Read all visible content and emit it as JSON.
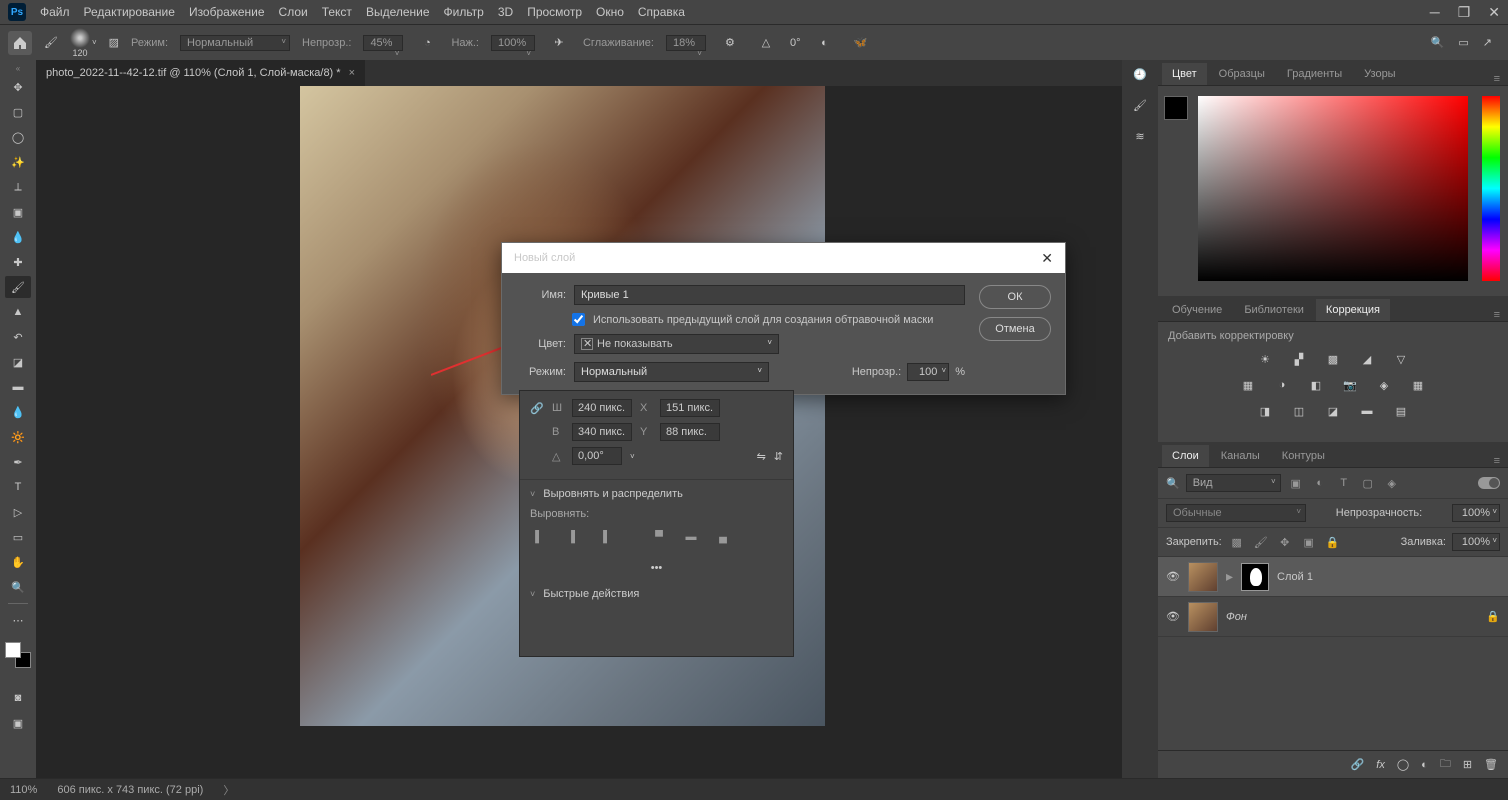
{
  "menubar": {
    "items": [
      "Файл",
      "Редактирование",
      "Изображение",
      "Слои",
      "Текст",
      "Выделение",
      "Фильтр",
      "3D",
      "Просмотр",
      "Окно",
      "Справка"
    ]
  },
  "optbar": {
    "brush_size": "120",
    "mode_label": "Режим:",
    "mode_value": "Нормальный",
    "opacity_label": "Непрозр.:",
    "opacity_value": "45%",
    "flow_label": "Наж.:",
    "flow_value": "100%",
    "smooth_label": "Сглаживание:",
    "smooth_value": "18%",
    "angle_value": "0°"
  },
  "tab_title": "photo_2022-11--42-12.tif @ 110% (Слой 1, Слой-маска/8) *",
  "dialog": {
    "title": "Новый слой",
    "name_label": "Имя:",
    "name_value": "Кривые 1",
    "clip_label": "Использовать предыдущий слой для создания обтравочной маски",
    "color_label": "Цвет:",
    "color_value": "Не показывать",
    "mode_label": "Режим:",
    "mode_value": "Нормальный",
    "opacity_label": "Непрозр.:",
    "opacity_value": "100",
    "opacity_pct": "%",
    "ok": "ОК",
    "cancel": "Отмена"
  },
  "props": {
    "w_label": "Ш",
    "w": "240 пикс.",
    "x_label": "X",
    "x": "151 пикс.",
    "h_label": "В",
    "h": "340 пикс.",
    "y_label": "Y",
    "y": "88 пикс.",
    "angle": "0,00°",
    "align_title": "Выровнять и распределить",
    "align_sub": "Выровнять:",
    "quick_title": "Быстрые действия"
  },
  "right": {
    "color_tabs": [
      "Цвет",
      "Образцы",
      "Градиенты",
      "Узоры"
    ],
    "mid_tabs": [
      "Обучение",
      "Библиотеки",
      "Коррекция"
    ],
    "corr_label": "Добавить корректировку",
    "layer_tabs": [
      "Слои",
      "Каналы",
      "Контуры"
    ],
    "search_placeholder": "Вид",
    "blend": "Обычные",
    "opacity_label": "Непрозрачность:",
    "opacity": "100%",
    "lock_label": "Закрепить:",
    "fill_label": "Заливка:",
    "fill": "100%",
    "layers": [
      {
        "name": "Слой 1"
      },
      {
        "name": "Фон"
      }
    ]
  },
  "status": {
    "zoom": "110%",
    "dims": "606 пикс. x 743 пикс. (72 ppi)"
  }
}
